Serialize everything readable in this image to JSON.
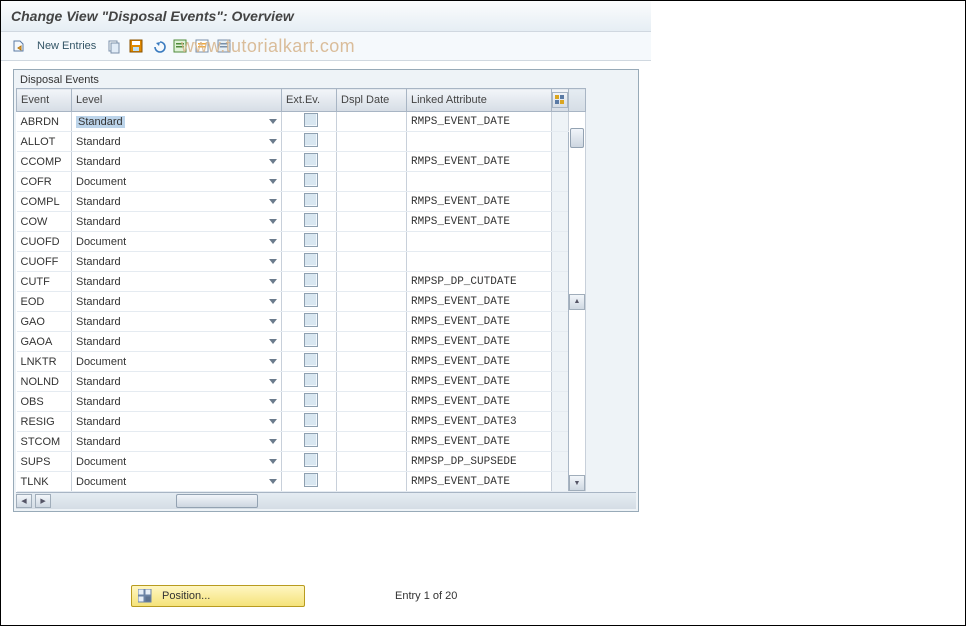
{
  "page": {
    "title": "Change View \"Disposal Events\": Overview"
  },
  "toolbar": {
    "new_entries_label": "New Entries",
    "watermark": "www.tutorialkart.com"
  },
  "grid": {
    "title": "Disposal Events",
    "columns": {
      "event": "Event",
      "level": "Level",
      "extev": "Ext.Ev.",
      "dspl": "Dspl Date",
      "attr": "Linked Attribute"
    },
    "rows": [
      {
        "event": "ABRDN",
        "level": "Standard",
        "attr": "RMPS_EVENT_DATE",
        "selected": true
      },
      {
        "event": "ALLOT",
        "level": "Standard",
        "attr": ""
      },
      {
        "event": "CCOMP",
        "level": "Standard",
        "attr": "RMPS_EVENT_DATE"
      },
      {
        "event": "COFR",
        "level": "Document",
        "attr": ""
      },
      {
        "event": "COMPL",
        "level": "Standard",
        "attr": "RMPS_EVENT_DATE"
      },
      {
        "event": "COW",
        "level": "Standard",
        "attr": "RMPS_EVENT_DATE"
      },
      {
        "event": "CUOFD",
        "level": "Document",
        "attr": ""
      },
      {
        "event": "CUOFF",
        "level": "Standard",
        "attr": ""
      },
      {
        "event": "CUTF",
        "level": "Standard",
        "attr": "RMPSP_DP_CUTDATE"
      },
      {
        "event": "EOD",
        "level": "Standard",
        "attr": "RMPS_EVENT_DATE"
      },
      {
        "event": "GAO",
        "level": "Standard",
        "attr": "RMPS_EVENT_DATE"
      },
      {
        "event": "GAOA",
        "level": "Standard",
        "attr": "RMPS_EVENT_DATE"
      },
      {
        "event": "LNKTR",
        "level": "Document",
        "attr": "RMPS_EVENT_DATE"
      },
      {
        "event": "NOLND",
        "level": "Standard",
        "attr": "RMPS_EVENT_DATE"
      },
      {
        "event": "OBS",
        "level": "Standard",
        "attr": "RMPS_EVENT_DATE"
      },
      {
        "event": "RESIG",
        "level": "Standard",
        "attr": "RMPS_EVENT_DATE3"
      },
      {
        "event": "STCOM",
        "level": "Standard",
        "attr": "RMPS_EVENT_DATE"
      },
      {
        "event": "SUPS",
        "level": "Document",
        "attr": "RMPSP_DP_SUPSEDE"
      },
      {
        "event": "TLNK",
        "level": "Document",
        "attr": "RMPS_EVENT_DATE"
      }
    ]
  },
  "footer": {
    "position_button": "Position...",
    "entry_text": "Entry 1 of 20"
  }
}
